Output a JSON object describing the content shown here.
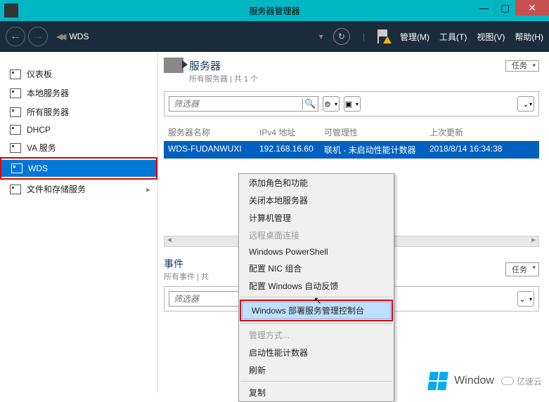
{
  "window": {
    "title": "服务器管理器"
  },
  "toolbar": {
    "brand": "WDS",
    "menu": {
      "manage": "管理(M)",
      "tools": "工具(T)",
      "view": "视图(V)",
      "help": "帮助(H)"
    }
  },
  "sidebar": {
    "items": [
      {
        "label": "仪表板"
      },
      {
        "label": "本地服务器"
      },
      {
        "label": "所有服务器"
      },
      {
        "label": "DHCP"
      },
      {
        "label": "VA 服务"
      },
      {
        "label": "WDS"
      },
      {
        "label": "文件和存储服务"
      }
    ]
  },
  "servers_panel": {
    "title": "服务器",
    "subtitle": "所有服务器 | 共 1 个",
    "tasks_label": "任务",
    "filter_placeholder": "筛选器",
    "columns": {
      "name": "服务器名称",
      "ip": "IPv4 地址",
      "manage": "可管理性",
      "updated": "上次更新"
    },
    "row": {
      "name": "WDS-FUDANWUXI",
      "ip": "192.168.16.60",
      "manage": "联机 - 未启动性能计数器",
      "updated": "2018/8/14 16:34:38"
    }
  },
  "context_menu": {
    "items": [
      "添加角色和功能",
      "关闭本地服务器",
      "计算机管理",
      "远程桌面连接",
      "Windows PowerShell",
      "配置 NIC 组合",
      "配置 Windows 自动反馈",
      "Windows 部署服务管理控制台",
      "管理方式...",
      "启动性能计数器",
      "刷新",
      "复制"
    ]
  },
  "events_panel": {
    "title": "事件",
    "subtitle": "所有事件 | 共",
    "tasks_label": "任务",
    "filter_placeholder": "筛选器"
  },
  "footer": {
    "win": "Window",
    "brand": "亿速云"
  }
}
